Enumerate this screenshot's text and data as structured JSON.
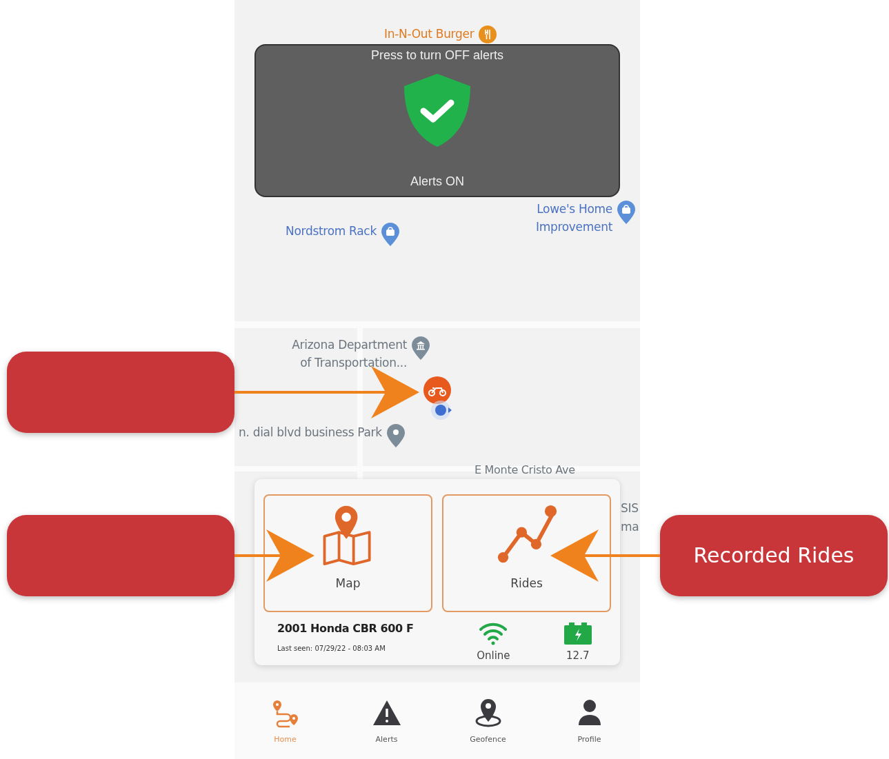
{
  "map": {
    "places": [
      {
        "kind": "food",
        "label": "In-N-Out Burger"
      },
      {
        "kind": "shop",
        "label": "Nordstrom Rack"
      },
      {
        "kind": "shop",
        "label": "Lowe's Home Improvement"
      },
      {
        "kind": "government",
        "label": "Arizona Department of Transportation..."
      },
      {
        "kind": "pin",
        "label": "n. dial blvd business Park"
      }
    ],
    "street": "E Monte Cristo Ave",
    "edge_labels": [
      "SIS",
      "ma"
    ]
  },
  "alert_toggle": {
    "hint": "Press to turn OFF alerts",
    "on": true,
    "status": "Alerts ON"
  },
  "actions": [
    {
      "kind": "map",
      "label": "Map"
    },
    {
      "kind": "rides",
      "label": "Rides"
    }
  ],
  "vehicle": {
    "name": "2001 Honda CBR 600 F",
    "last_seen": "Last seen: 07/29/22 - 08:03 AM",
    "connection": "Online",
    "battery": "12.7"
  },
  "nav": [
    {
      "kind": "home",
      "label": "Home",
      "selected": true
    },
    {
      "kind": "alerts",
      "label": "Alerts",
      "selected": false
    },
    {
      "kind": "geofence",
      "label": "Geofence",
      "selected": false
    },
    {
      "kind": "profile",
      "label": "Profile",
      "selected": false
    }
  ],
  "callouts": [
    {
      "kind": "marker"
    },
    {
      "kind": "map"
    },
    {
      "kind": "rides",
      "text": "Recorded Rides"
    }
  ]
}
